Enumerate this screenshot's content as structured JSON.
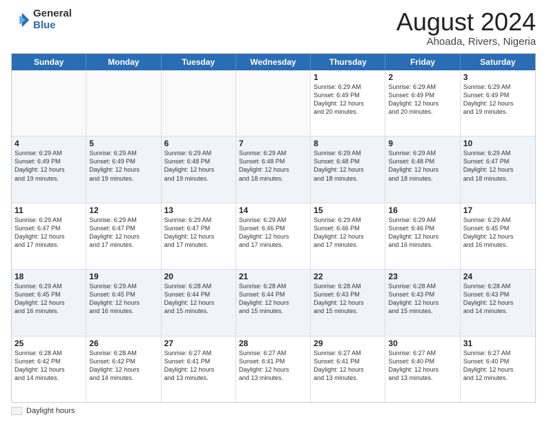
{
  "logo": {
    "general": "General",
    "blue": "Blue"
  },
  "title": {
    "month_year": "August 2024",
    "location": "Ahoada, Rivers, Nigeria"
  },
  "header_days": [
    "Sunday",
    "Monday",
    "Tuesday",
    "Wednesday",
    "Thursday",
    "Friday",
    "Saturday"
  ],
  "weeks": [
    {
      "alt": false,
      "cells": [
        {
          "day": "",
          "info": ""
        },
        {
          "day": "",
          "info": ""
        },
        {
          "day": "",
          "info": ""
        },
        {
          "day": "",
          "info": ""
        },
        {
          "day": "1",
          "info": "Sunrise: 6:29 AM\nSunset: 6:49 PM\nDaylight: 12 hours\nand 20 minutes."
        },
        {
          "day": "2",
          "info": "Sunrise: 6:29 AM\nSunset: 6:49 PM\nDaylight: 12 hours\nand 20 minutes."
        },
        {
          "day": "3",
          "info": "Sunrise: 6:29 AM\nSunset: 6:49 PM\nDaylight: 12 hours\nand 19 minutes."
        }
      ]
    },
    {
      "alt": true,
      "cells": [
        {
          "day": "4",
          "info": "Sunrise: 6:29 AM\nSunset: 6:49 PM\nDaylight: 12 hours\nand 19 minutes."
        },
        {
          "day": "5",
          "info": "Sunrise: 6:29 AM\nSunset: 6:49 PM\nDaylight: 12 hours\nand 19 minutes."
        },
        {
          "day": "6",
          "info": "Sunrise: 6:29 AM\nSunset: 6:48 PM\nDaylight: 12 hours\nand 19 minutes."
        },
        {
          "day": "7",
          "info": "Sunrise: 6:29 AM\nSunset: 6:48 PM\nDaylight: 12 hours\nand 18 minutes."
        },
        {
          "day": "8",
          "info": "Sunrise: 6:29 AM\nSunset: 6:48 PM\nDaylight: 12 hours\nand 18 minutes."
        },
        {
          "day": "9",
          "info": "Sunrise: 6:29 AM\nSunset: 6:48 PM\nDaylight: 12 hours\nand 18 minutes."
        },
        {
          "day": "10",
          "info": "Sunrise: 6:29 AM\nSunset: 6:47 PM\nDaylight: 12 hours\nand 18 minutes."
        }
      ]
    },
    {
      "alt": false,
      "cells": [
        {
          "day": "11",
          "info": "Sunrise: 6:29 AM\nSunset: 6:47 PM\nDaylight: 12 hours\nand 17 minutes."
        },
        {
          "day": "12",
          "info": "Sunrise: 6:29 AM\nSunset: 6:47 PM\nDaylight: 12 hours\nand 17 minutes."
        },
        {
          "day": "13",
          "info": "Sunrise: 6:29 AM\nSunset: 6:47 PM\nDaylight: 12 hours\nand 17 minutes."
        },
        {
          "day": "14",
          "info": "Sunrise: 6:29 AM\nSunset: 6:46 PM\nDaylight: 12 hours\nand 17 minutes."
        },
        {
          "day": "15",
          "info": "Sunrise: 6:29 AM\nSunset: 6:46 PM\nDaylight: 12 hours\nand 17 minutes."
        },
        {
          "day": "16",
          "info": "Sunrise: 6:29 AM\nSunset: 6:46 PM\nDaylight: 12 hours\nand 16 minutes."
        },
        {
          "day": "17",
          "info": "Sunrise: 6:29 AM\nSunset: 6:45 PM\nDaylight: 12 hours\nand 16 minutes."
        }
      ]
    },
    {
      "alt": true,
      "cells": [
        {
          "day": "18",
          "info": "Sunrise: 6:29 AM\nSunset: 6:45 PM\nDaylight: 12 hours\nand 16 minutes."
        },
        {
          "day": "19",
          "info": "Sunrise: 6:29 AM\nSunset: 6:45 PM\nDaylight: 12 hours\nand 16 minutes."
        },
        {
          "day": "20",
          "info": "Sunrise: 6:28 AM\nSunset: 6:44 PM\nDaylight: 12 hours\nand 15 minutes."
        },
        {
          "day": "21",
          "info": "Sunrise: 6:28 AM\nSunset: 6:44 PM\nDaylight: 12 hours\nand 15 minutes."
        },
        {
          "day": "22",
          "info": "Sunrise: 6:28 AM\nSunset: 6:43 PM\nDaylight: 12 hours\nand 15 minutes."
        },
        {
          "day": "23",
          "info": "Sunrise: 6:28 AM\nSunset: 6:43 PM\nDaylight: 12 hours\nand 15 minutes."
        },
        {
          "day": "24",
          "info": "Sunrise: 6:28 AM\nSunset: 6:43 PM\nDaylight: 12 hours\nand 14 minutes."
        }
      ]
    },
    {
      "alt": false,
      "cells": [
        {
          "day": "25",
          "info": "Sunrise: 6:28 AM\nSunset: 6:42 PM\nDaylight: 12 hours\nand 14 minutes."
        },
        {
          "day": "26",
          "info": "Sunrise: 6:28 AM\nSunset: 6:42 PM\nDaylight: 12 hours\nand 14 minutes."
        },
        {
          "day": "27",
          "info": "Sunrise: 6:27 AM\nSunset: 6:41 PM\nDaylight: 12 hours\nand 13 minutes."
        },
        {
          "day": "28",
          "info": "Sunrise: 6:27 AM\nSunset: 6:41 PM\nDaylight: 12 hours\nand 13 minutes."
        },
        {
          "day": "29",
          "info": "Sunrise: 6:27 AM\nSunset: 6:41 PM\nDaylight: 12 hours\nand 13 minutes."
        },
        {
          "day": "30",
          "info": "Sunrise: 6:27 AM\nSunset: 6:40 PM\nDaylight: 12 hours\nand 13 minutes."
        },
        {
          "day": "31",
          "info": "Sunrise: 6:27 AM\nSunset: 6:40 PM\nDaylight: 12 hours\nand 12 minutes."
        }
      ]
    }
  ],
  "legend": {
    "label": "Daylight hours"
  }
}
